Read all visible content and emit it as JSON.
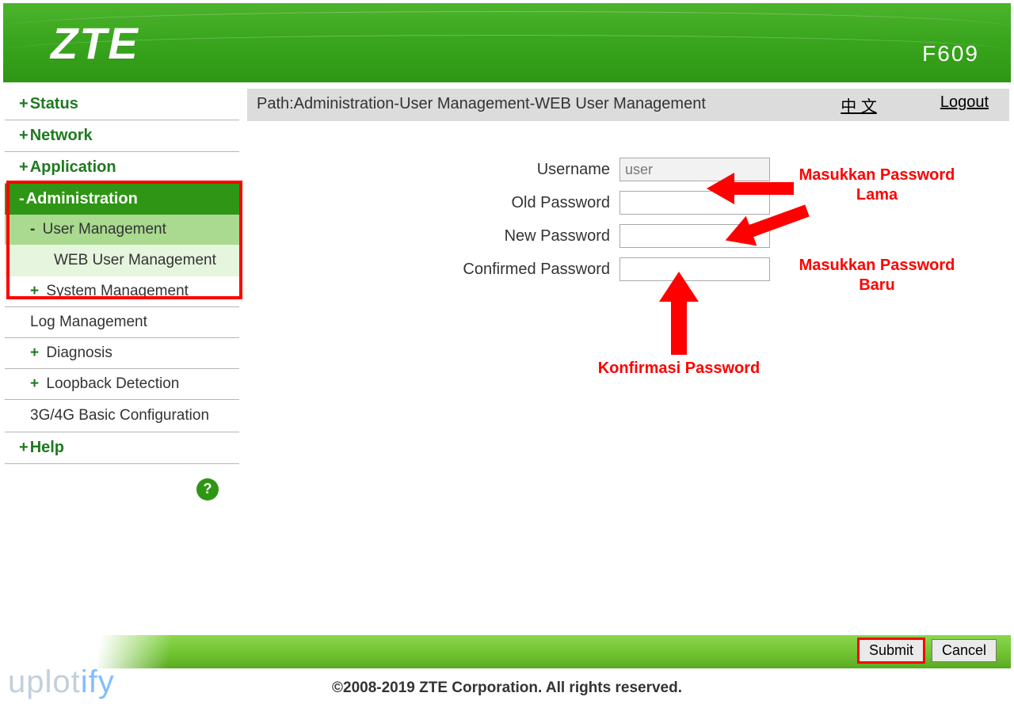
{
  "header": {
    "brand": "ZTE",
    "model": "F609"
  },
  "sidebar": {
    "items": [
      {
        "label": "Status",
        "prefix": "+"
      },
      {
        "label": "Network",
        "prefix": "+"
      },
      {
        "label": "Application",
        "prefix": "+"
      },
      {
        "label": "Administration",
        "prefix": "-",
        "active": true,
        "children": [
          {
            "label": "User Management",
            "prefix": "-",
            "active": true,
            "children": [
              {
                "label": "WEB User Management",
                "active": true
              }
            ]
          },
          {
            "label": "System Management",
            "prefix": "+"
          },
          {
            "label": "Log Management",
            "prefix": ""
          },
          {
            "label": "Diagnosis",
            "prefix": "+"
          },
          {
            "label": "Loopback Detection",
            "prefix": "+"
          },
          {
            "label": "3G/4G Basic Configuration",
            "prefix": ""
          }
        ]
      },
      {
        "label": "Help",
        "prefix": "+"
      }
    ],
    "help_tooltip": "?"
  },
  "pathbar": {
    "path_text": "Path:Administration-User Management-WEB User Management",
    "lang_link": "中 文",
    "logout_link": "Logout"
  },
  "form": {
    "username_label": "Username",
    "username_value": "user",
    "old_pw_label": "Old Password",
    "new_pw_label": "New Password",
    "confirm_pw_label": "Confirmed Password"
  },
  "annotations": {
    "old_pw": "Masukkan Password Lama",
    "new_pw": "Masukkan Password Baru",
    "confirm_pw": "Konfirmasi Password"
  },
  "footer": {
    "submit": "Submit",
    "cancel": "Cancel",
    "copyright": "©2008-2019 ZTE Corporation. All rights reserved."
  },
  "watermark": {
    "part1": "uplot",
    "part2": "ify"
  }
}
